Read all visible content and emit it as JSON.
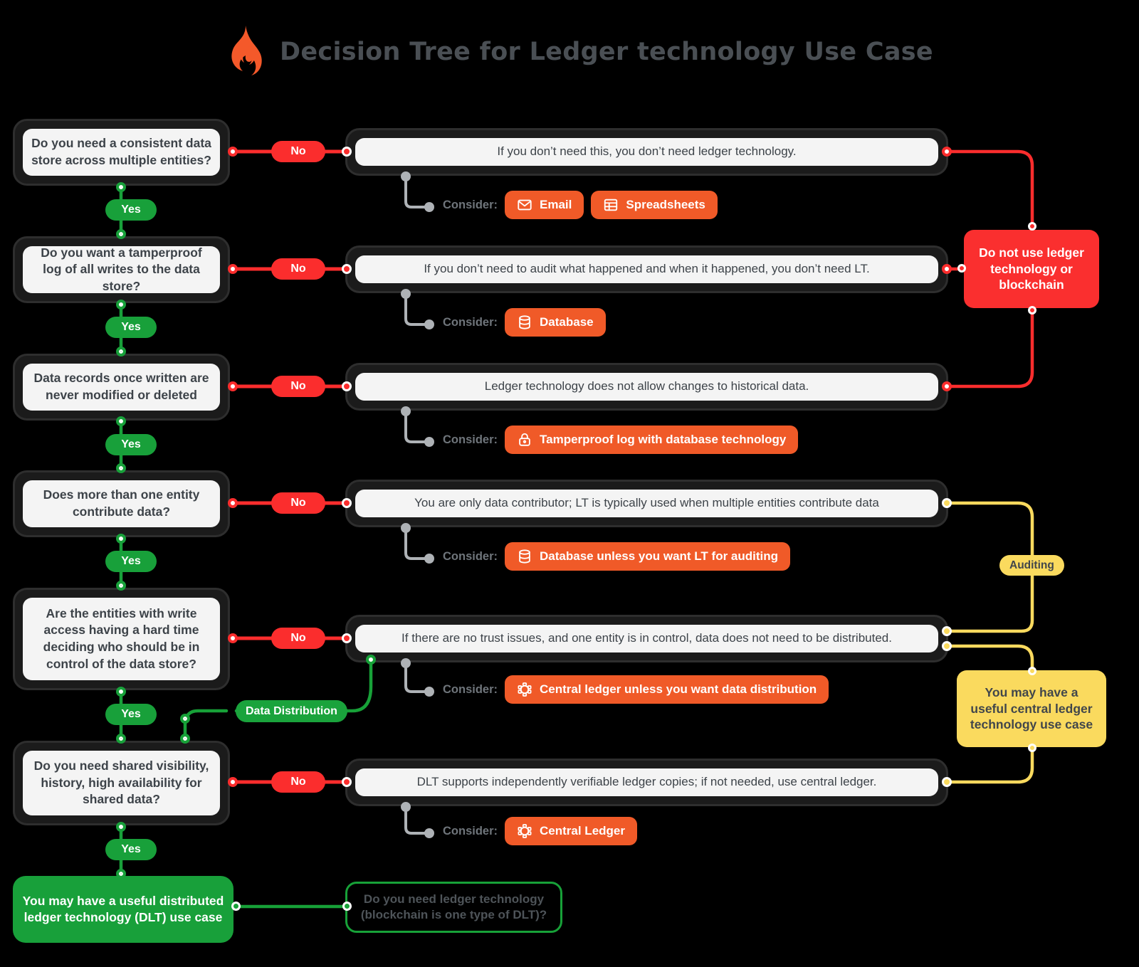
{
  "header": {
    "title": "Decision Tree for Ledger technology Use Case",
    "logo_icon": "flame-icon"
  },
  "labels": {
    "consider": "Consider:",
    "yes": "Yes",
    "no": "No",
    "data_distribution": "Data Distribution",
    "auditing": "Auditing"
  },
  "questions": [
    {
      "id": "q1",
      "text": "Do you need a consistent data store across multiple entities?"
    },
    {
      "id": "q2",
      "text": "Do you want a tamperproof log of all writes to the data store?"
    },
    {
      "id": "q3",
      "text": "Data records once written are never modified or deleted"
    },
    {
      "id": "q4",
      "text": "Does more than one entity contribute data?"
    },
    {
      "id": "q5",
      "text": "Are the entities with write access having a hard time deciding who should be in control of the data store?"
    },
    {
      "id": "q6",
      "text": "Do you need shared visibility, history, high availability for shared data?"
    }
  ],
  "outcomes": [
    {
      "id": "o1",
      "text": "If you don’t need this, you don’t need ledger technology."
    },
    {
      "id": "o2",
      "text": "If you don’t need to audit what happened and when it happened, you don’t need LT."
    },
    {
      "id": "o3",
      "text": "Ledger technology does not allow changes to historical data."
    },
    {
      "id": "o4",
      "text": "You are only data contributor; LT is typically used when multiple entities contribute data"
    },
    {
      "id": "o5",
      "text": "If there are no trust issues, and one entity is in control, data does not need to be distributed."
    },
    {
      "id": "o6",
      "text": "DLT supports independently verifiable ledger copies; if not needed, use central ledger."
    }
  ],
  "consider_rows": [
    {
      "id": "c1",
      "chips": [
        {
          "label": "Email",
          "icon": "envelope-icon"
        },
        {
          "label": "Spreadsheets",
          "icon": "table-icon"
        }
      ]
    },
    {
      "id": "c2",
      "chips": [
        {
          "label": "Database",
          "icon": "database-icon"
        }
      ]
    },
    {
      "id": "c3",
      "chips": [
        {
          "label": "Tamperproof log with database technology",
          "icon": "lock-icon"
        }
      ]
    },
    {
      "id": "c4",
      "chips": [
        {
          "label": "Database unless you want LT for auditing",
          "icon": "database-icon"
        }
      ]
    },
    {
      "id": "c5",
      "chips": [
        {
          "label": "Central ledger unless you want data distribution",
          "icon": "network-icon"
        }
      ]
    },
    {
      "id": "c6",
      "chips": [
        {
          "label": "Central Ledger",
          "icon": "network-icon"
        }
      ]
    }
  ],
  "terminals": {
    "no_ledger": "Do not use ledger technology or blockchain",
    "central_ledger": "You may have a useful central ledger technology use case",
    "dlt": "You may have a useful distributed ledger technology (DLT) use case",
    "question_footer": "Do you need ledger technology (blockchain is one type of DLT)?"
  },
  "colors": {
    "red": "#fa2f2f",
    "green": "#18a03a",
    "yellow": "#fada5e",
    "orange": "#f05a28",
    "gray": "#aeb2b6",
    "panel": "#f4f4f4",
    "border": "#2e2e2e",
    "background": "#000000"
  }
}
